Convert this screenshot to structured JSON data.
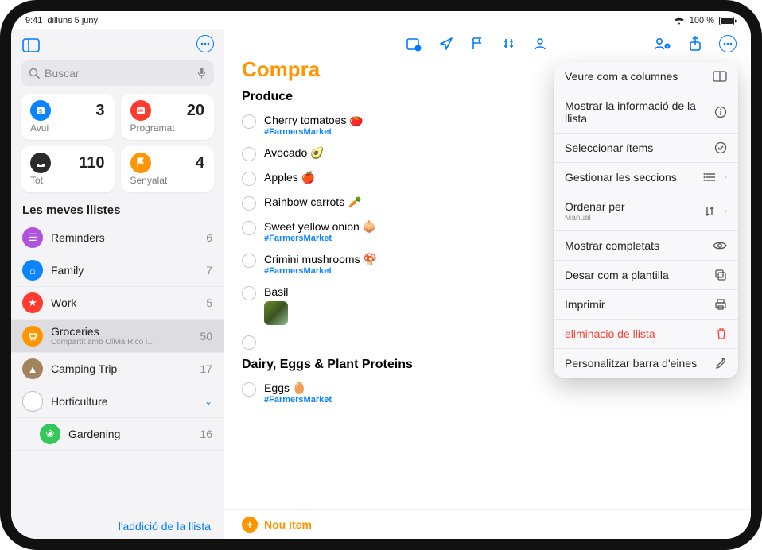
{
  "status": {
    "time": "9:41",
    "date": "dilluns 5 juny",
    "battery": "100 %"
  },
  "search": {
    "placeholder": "Buscar"
  },
  "smart": {
    "today": {
      "label": "Avui",
      "count": 3
    },
    "scheduled": {
      "label": "Programat",
      "count": 20
    },
    "all": {
      "label": "Tot",
      "count": 110
    },
    "flagged": {
      "label": "Senyalat",
      "count": 4
    }
  },
  "sidebar": {
    "section_title": "Les meves llistes",
    "items": [
      {
        "name": "Reminders",
        "count": 6
      },
      {
        "name": "Family",
        "count": 7
      },
      {
        "name": "Work",
        "count": 5
      },
      {
        "name": "Groceries",
        "count": 50,
        "sub": "Compartit amb Olivia Rico i…"
      },
      {
        "name": "Camping Trip",
        "count": 17
      },
      {
        "name": "Horticulture"
      },
      {
        "name": "Gardening",
        "count": 16
      }
    ],
    "add_list": "l'addició de la llista"
  },
  "list": {
    "title": "Compra",
    "sections": [
      {
        "heading": "Produce",
        "items": [
          {
            "title": "Cherry tomatoes 🍅",
            "tag": "#FarmersMarket"
          },
          {
            "title": "Avocado 🥑"
          },
          {
            "title": "Apples 🍎"
          },
          {
            "title": "Rainbow carrots 🥕"
          },
          {
            "title": "Sweet yellow onion 🧅",
            "tag": "#FarmersMarket"
          },
          {
            "title": "Crimini mushrooms 🍄",
            "tag": "#FarmersMarket"
          },
          {
            "title": "Basil",
            "has_image": true
          }
        ]
      },
      {
        "heading": "Dairy, Eggs & Plant Proteins",
        "items": [
          {
            "title": "Eggs 🥚",
            "tag": "#FarmersMarket"
          }
        ]
      }
    ],
    "new_item": "Nou ítem"
  },
  "menu": {
    "rows": [
      {
        "label": "Veure com a columnes",
        "icon": "columns"
      },
      {
        "label": "Mostrar la informació de la llista",
        "icon": "info"
      },
      {
        "label": "Seleccionar ítems",
        "icon": "check-circle"
      },
      {
        "label": "Gestionar les seccions",
        "icon": "list",
        "chevron": true
      },
      {
        "label": "Ordenar per",
        "sub": "Manual",
        "icon": "sort",
        "chevron": true
      },
      {
        "label": "Mostrar completats",
        "icon": "eye"
      },
      {
        "label": "Desar com a plantilla",
        "icon": "template"
      },
      {
        "label": "Imprimir",
        "icon": "print"
      },
      {
        "label": "eliminació de llista",
        "icon": "trash",
        "danger": true
      },
      {
        "label": "Personalitzar barra d'eines",
        "icon": "wrench"
      }
    ]
  }
}
